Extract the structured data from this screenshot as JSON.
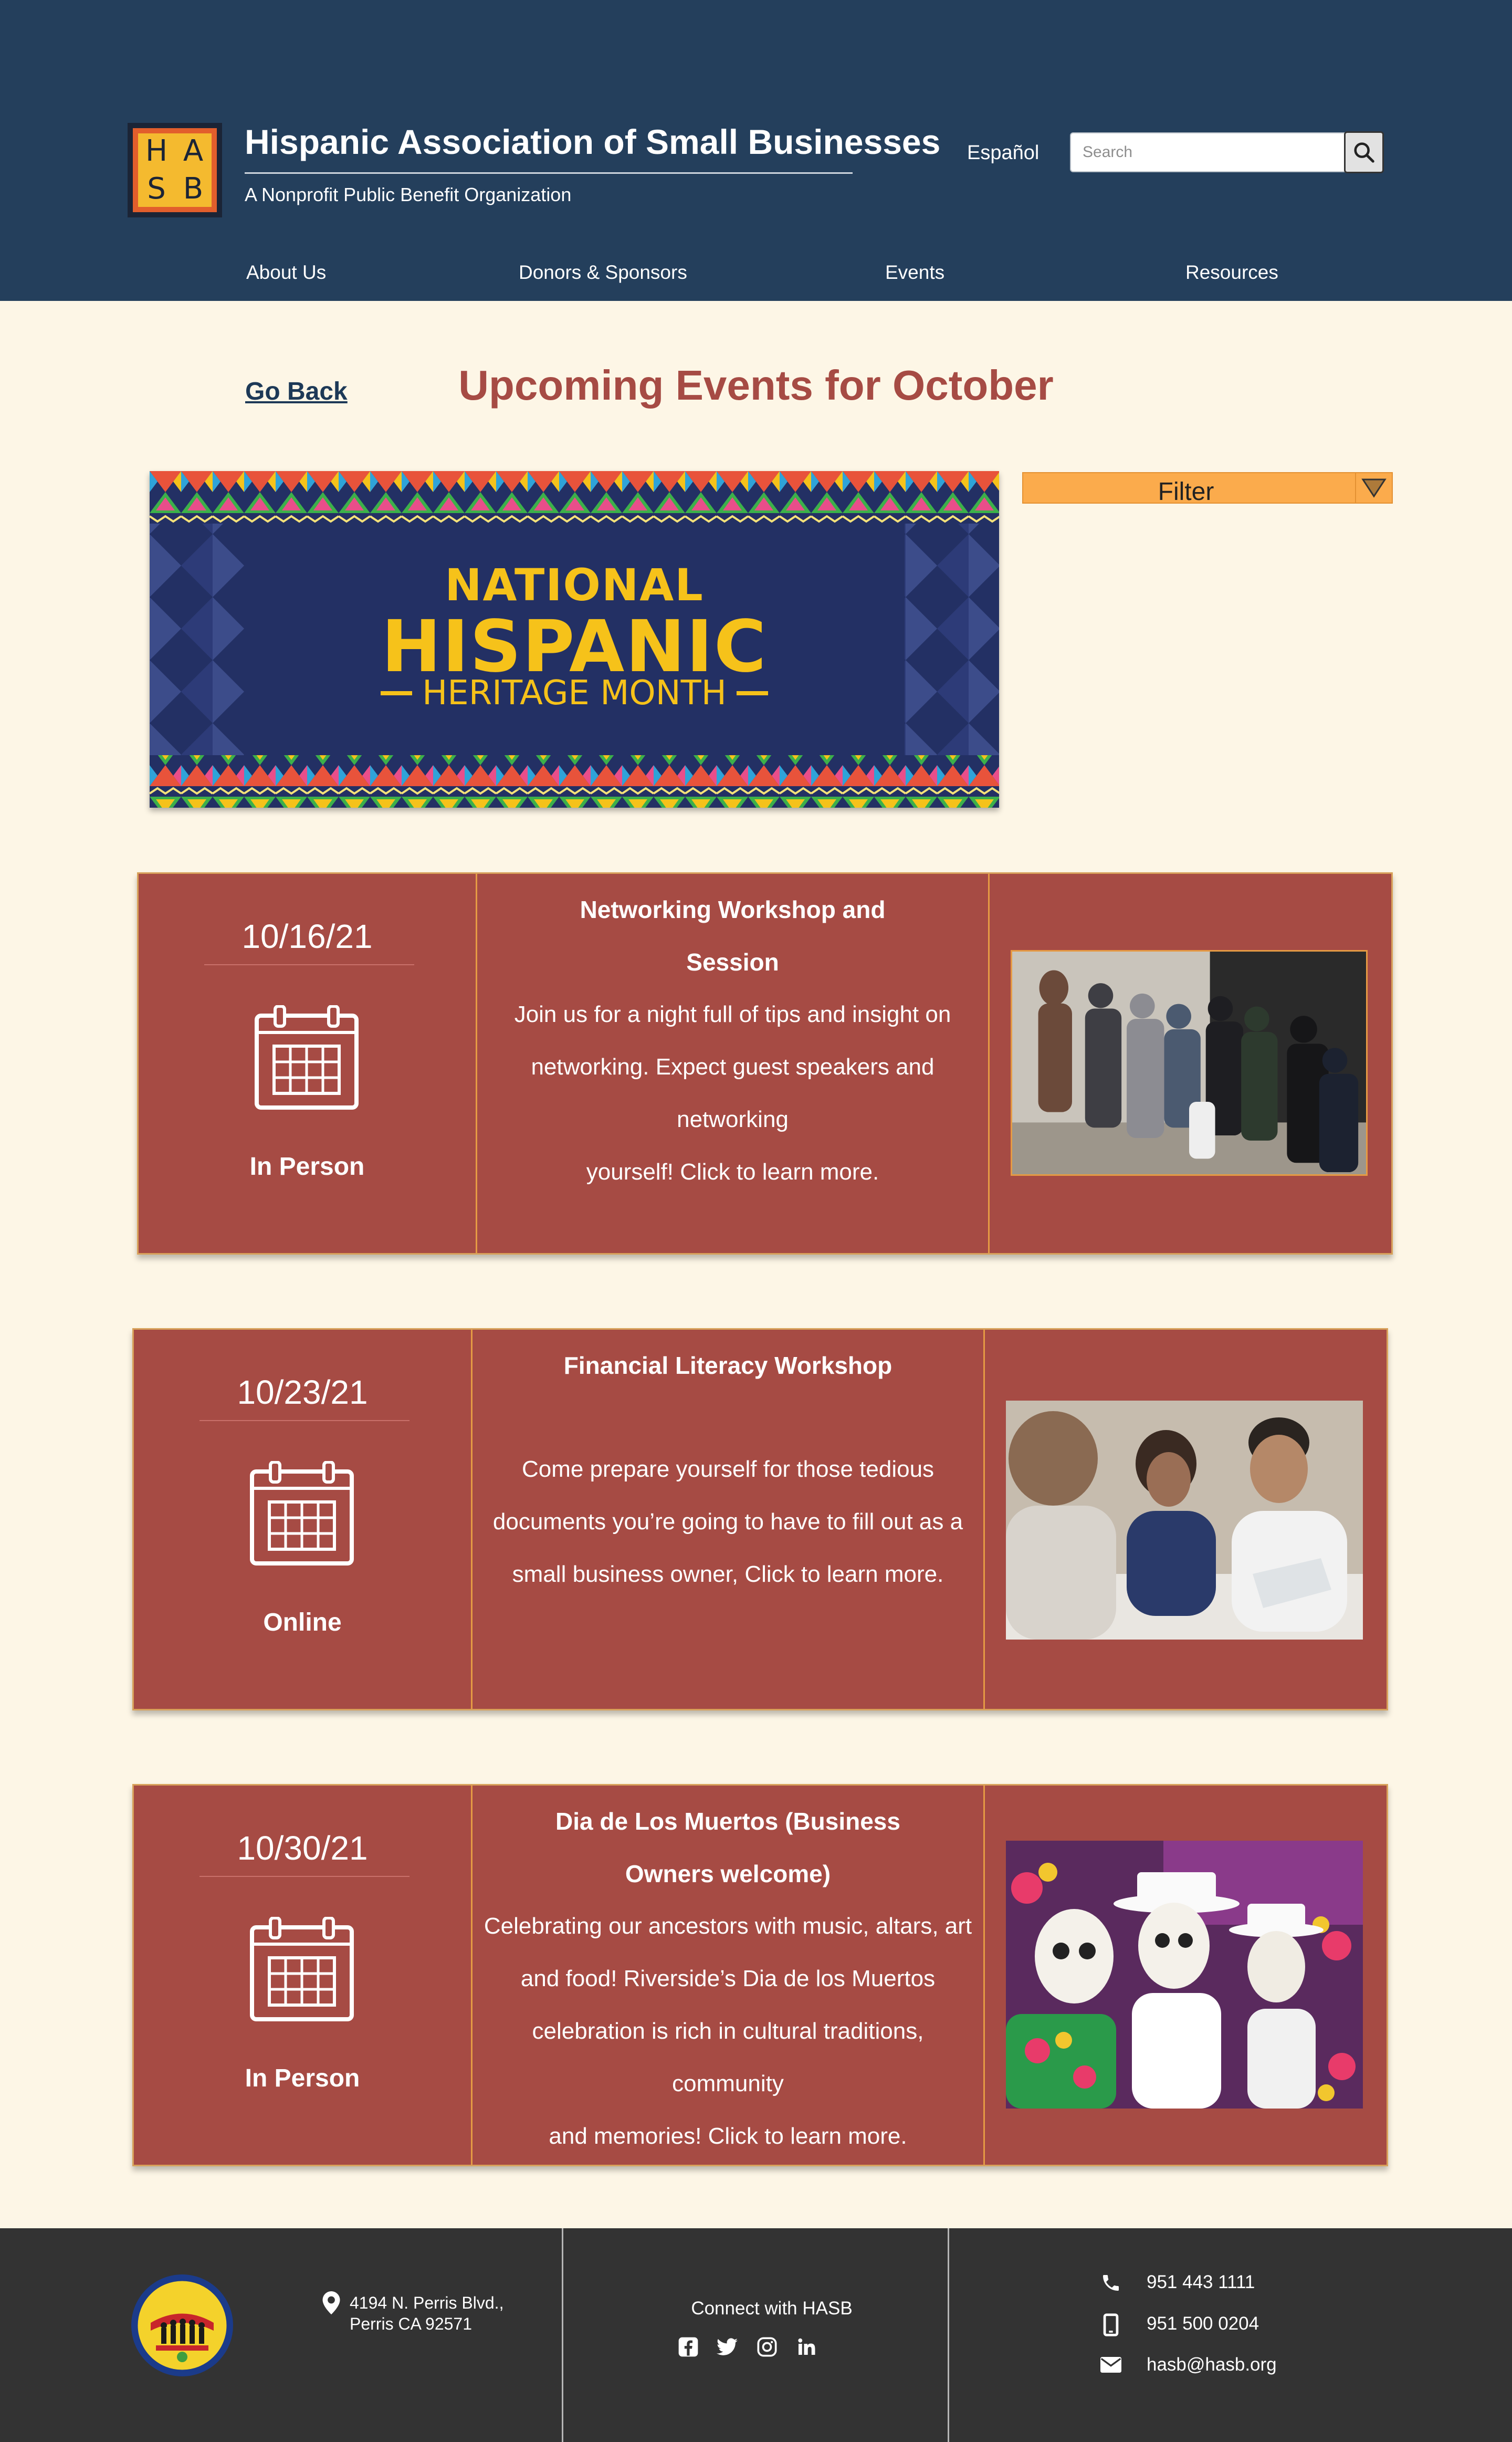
{
  "header": {
    "logo_letters": [
      "H",
      "A",
      "S",
      "B"
    ],
    "title": "Hispanic Association of Small Businesses",
    "subtitle": "A Nonprofit Public Benefit Organization",
    "language_link": "Español",
    "search": {
      "placeholder": "Search",
      "value": ""
    },
    "nav": [
      "About Us",
      "Donors & Sponsors",
      "Events",
      "Resources"
    ]
  },
  "page": {
    "go_back": "Go Back",
    "title": "Upcoming Events for October"
  },
  "banner": {
    "line1": "NATIONAL",
    "line2": "HISPANIC",
    "line3": "HERITAGE MONTH"
  },
  "filter": {
    "label": "Filter"
  },
  "events": [
    {
      "date": "10/16/21",
      "mode": "In Person",
      "title_lines": [
        "Networking Workshop and",
        "Session"
      ],
      "desc_lines": [
        "Join us for a night full of tips and insight on",
        "networking. Expect guest speakers and networking",
        "yourself! Click to learn more."
      ]
    },
    {
      "date": "10/23/21",
      "mode": "Online",
      "title_lines": [
        "Financial Literacy Workshop"
      ],
      "desc_lines": [
        "Come prepare yourself for those tedious",
        "documents you’re going to have to fill out as a",
        "small business owner, Click to learn more."
      ]
    },
    {
      "date": "10/30/21",
      "mode": "In Person",
      "title_lines": [
        "Dia de Los Muertos (Business",
        "Owners welcome)"
      ],
      "desc_lines": [
        "Celebrating our ancestors with music, altars, art",
        "and food! Riverside’s Dia de los Muertos",
        "celebration is rich in cultural traditions, community",
        "and memories! Click to learn more."
      ]
    }
  ],
  "footer": {
    "address_lines": [
      "4194 N. Perris Blvd.,",
      "Perris CA 92571"
    ],
    "connect_label": "Connect with HASB",
    "social_icons": [
      "facebook-icon",
      "twitter-icon",
      "instagram-icon",
      "linkedin-icon"
    ],
    "phone": "951 443 1111",
    "mobile": "951 500 0204",
    "email": "hasb@hasb.org"
  },
  "colors": {
    "header_bg": "#243f5c",
    "page_bg": "#fdf6e6",
    "card_bg": "#a64b44",
    "title_color": "#a64b44",
    "filter_bg": "#fbab4c",
    "footer_bg": "#333333"
  }
}
